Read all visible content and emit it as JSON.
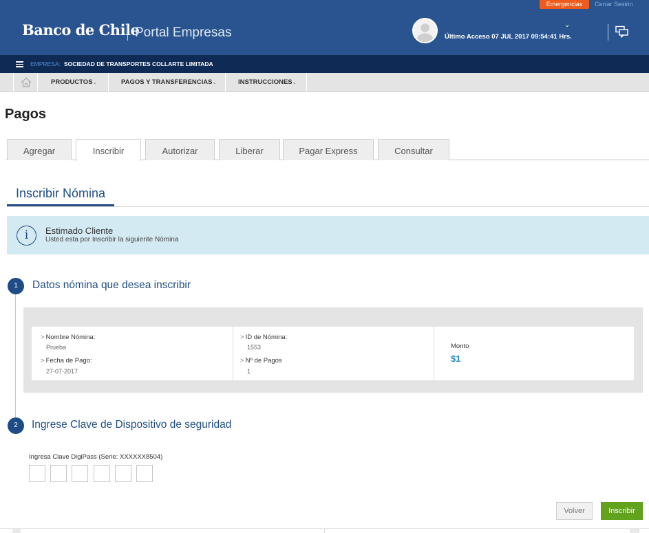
{
  "header": {
    "emergency_label": "Emergencias",
    "logout_label": "Cerrar Sesión",
    "logo_text": "Banco de Chile",
    "portal_title": "Portal Empresas",
    "last_access": "Último Acceso 07 JUL 2017 09:54:41 Hrs.",
    "brand_color": "#2a5490",
    "emergency_color": "#ee5b1c"
  },
  "company_bar": {
    "label": "EMPRESA:",
    "name": "SOCIEDAD DE TRANSPORTES COLLARTE LIMITADA"
  },
  "nav": {
    "items": [
      {
        "label": "PRODUCTOS",
        "chevron": "⌄"
      },
      {
        "label": "PAGOS Y TRANSFERENCIAS",
        "chevron": "⌄"
      },
      {
        "label": "INSTRUCCIONES",
        "chevron": "⌄"
      }
    ]
  },
  "page": {
    "title": "Pagos",
    "tabs": [
      {
        "label": "Agregar"
      },
      {
        "label": "Inscribir",
        "active": true
      },
      {
        "label": "Autorizar"
      },
      {
        "label": "Liberar"
      },
      {
        "label": "Pagar Express"
      },
      {
        "label": "Consultar"
      }
    ],
    "section_title": "Inscribir Nómina",
    "info": {
      "title": "Estimado Cliente",
      "text": "Usted esta por Inscribir la siguiente Nómina",
      "icon": "i"
    }
  },
  "steps": [
    {
      "number": "1",
      "title": "Datos nómina que desea inscribir"
    },
    {
      "number": "2",
      "title": "Ingrese Clave de Dispositivo de seguridad"
    }
  ],
  "summary": {
    "nombre_label": "Nombre Nómina:",
    "nombre_value": "Prueba",
    "fecha_label": "Fecha de Pago:",
    "fecha_value": "27-07-2017",
    "id_label": "ID de Nómina:",
    "id_value": "1553",
    "pagos_label": "Nº de Pagos",
    "pagos_value": "1",
    "monto_label": "Monto",
    "monto_value": "$1"
  },
  "digipass": {
    "label": "Ingresa Clave DigiPass (Serie: XXXXXX8504)",
    "digits": [
      "",
      "",
      "",
      "",
      "",
      ""
    ]
  },
  "actions": {
    "back_label": "Volver",
    "submit_label": "Inscribir",
    "submit_color": "#62a31e"
  }
}
